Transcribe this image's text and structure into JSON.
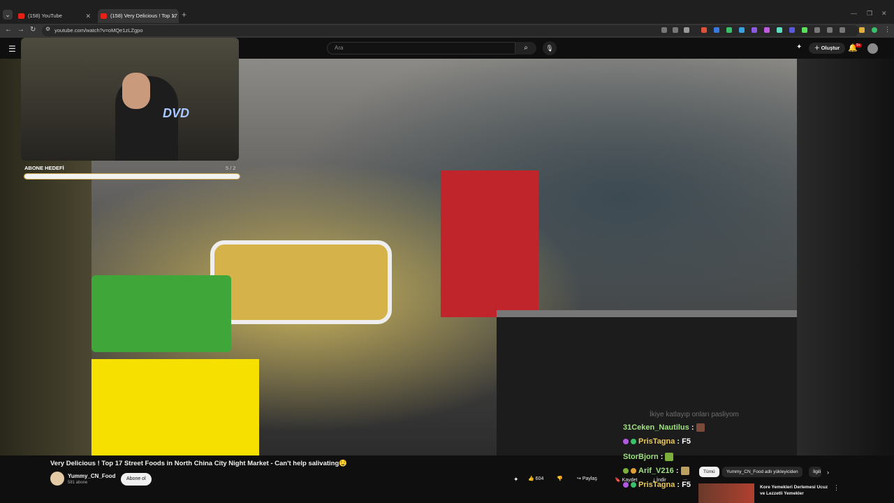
{
  "browser": {
    "tabs": [
      {
        "label": "(158) YouTube"
      },
      {
        "label": "(158) Very Delicious ! Top 17 St"
      }
    ],
    "url": "youtube.com/watch?v=oMQe1zLZgpo"
  },
  "header": {
    "search_placeholder": "Ara",
    "create_label": "Oluştur",
    "notifications_badge": "9+"
  },
  "overlay": {
    "webcam_logo": "DVD",
    "goal_label": "ABONE HEDEFİ",
    "goal_count": "5 / 2",
    "goal_progress": 1.0
  },
  "chat": {
    "faded_line": "İkiye katlayıp onları pasliyom",
    "lines": [
      {
        "user": "31Ceken_Nautilus",
        "text": "",
        "color": "#9ee37d"
      },
      {
        "user": "PrisTagna",
        "text": "F5",
        "color": "#e8c85a"
      },
      {
        "user": "StorBjorn",
        "text": "",
        "color": "#9ee37d"
      },
      {
        "user": "Arif_V216",
        "text": "",
        "color": "#9ee37d"
      },
      {
        "user": "PrisTagna",
        "text": "F5",
        "color": "#e8c85a"
      }
    ]
  },
  "video": {
    "title": "Very Delicious ! Top 17 Street Foods in North China City Night Market - Can't help salivating🤤",
    "channel": "Yummy_CN_Food",
    "subscribers": "581 abone",
    "subscribe_label": "Abone ol",
    "likes": "604",
    "share_label": "Paylaş",
    "save_label": "Kaydet",
    "download_label": "İndir",
    "more_label": "..."
  },
  "sidebar": {
    "chips": [
      "Tümü",
      "Yummy_CN_Food adlı yükleyiciden",
      "İlgili"
    ],
    "recommended_title": "Kore Yemekleri Derlemesi Ucuz ve Lezzetli Yemekler"
  }
}
